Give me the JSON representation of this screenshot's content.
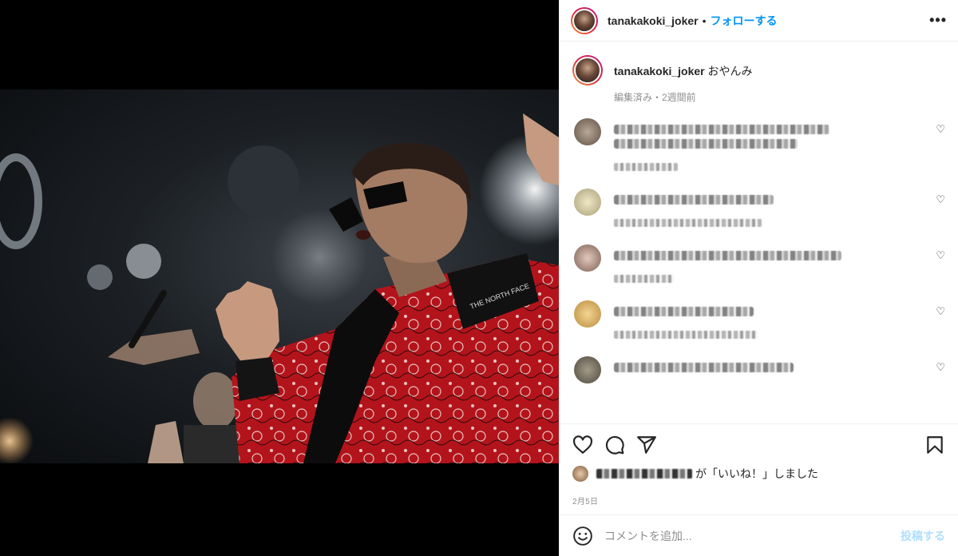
{
  "header": {
    "username": "tanakakoki_joker",
    "separator": "•",
    "follow_label": "フォローする",
    "more_label": "•••"
  },
  "caption": {
    "username": "tanakakoki_joker",
    "text": "おやんみ",
    "meta": "編集済み・2週間前"
  },
  "comments": [
    {
      "avatar_color": "#8a7b6e",
      "hidden": true
    },
    {
      "avatar_color": "#d8cfa9",
      "hidden": true
    },
    {
      "avatar_color": "#b79a8c",
      "hidden": true
    },
    {
      "avatar_color": "#e2c47f",
      "hidden": true
    },
    {
      "avatar_color": "#6f6a5c",
      "hidden": true
    }
  ],
  "actions": {
    "likes_suffix": "が「いいね！」しました",
    "date": "2月5日"
  },
  "add_comment": {
    "placeholder": "コメントを追加...",
    "post_label": "投稿する"
  },
  "icons": [
    "heart-icon",
    "comment-icon",
    "share-icon",
    "bookmark-icon",
    "emoji-icon",
    "more-icon"
  ]
}
